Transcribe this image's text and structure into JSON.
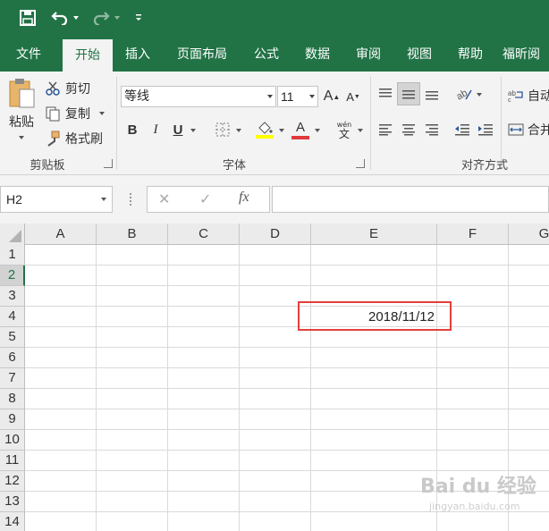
{
  "quick_access": {
    "save_icon": "save-icon",
    "undo_icon": "undo-icon",
    "redo_icon": "redo-icon",
    "customize_icon": "customize-qat-icon"
  },
  "tabs": [
    {
      "label": "文件"
    },
    {
      "label": "开始",
      "active": true
    },
    {
      "label": "插入"
    },
    {
      "label": "页面布局"
    },
    {
      "label": "公式"
    },
    {
      "label": "数据"
    },
    {
      "label": "审阅"
    },
    {
      "label": "视图"
    },
    {
      "label": "帮助"
    },
    {
      "label": "福昕阅"
    }
  ],
  "ribbon": {
    "clipboard": {
      "paste_label": "粘贴",
      "cut_label": "剪切",
      "copy_label": "复制",
      "format_painter_label": "格式刷",
      "group_label": "剪贴板"
    },
    "font": {
      "font_name": "等线",
      "font_size": "11",
      "bold": "B",
      "italic": "I",
      "underline": "U",
      "font_color_glyph": "A",
      "phonetic_glyph": "wén",
      "group_label": "字体"
    },
    "alignment": {
      "wrap_label": "自动",
      "merge_label": "合并",
      "group_label": "对齐方式"
    }
  },
  "formula_bar": {
    "name_box": "H2",
    "cancel_glyph": "✕",
    "enter_glyph": "✓",
    "fx_glyph": "fx",
    "content": ""
  },
  "grid": {
    "columns": [
      "A",
      "B",
      "C",
      "D",
      "E",
      "F",
      "G"
    ],
    "rows": [
      "1",
      "2",
      "3",
      "4",
      "5",
      "6",
      "7",
      "8",
      "9",
      "10",
      "11",
      "12",
      "13",
      "14"
    ],
    "cells": {
      "E4": "2018/11/12"
    }
  },
  "watermark": {
    "text": "Bai du 经验",
    "sub": "jingyan.baidu.com"
  },
  "colors": {
    "excel_green": "#217346",
    "ribbon_bg": "#f3f3f3",
    "highlight_red": "#e0413a",
    "font_color_red": "#e03a3a",
    "highlight_yellow": "#ffff00"
  }
}
